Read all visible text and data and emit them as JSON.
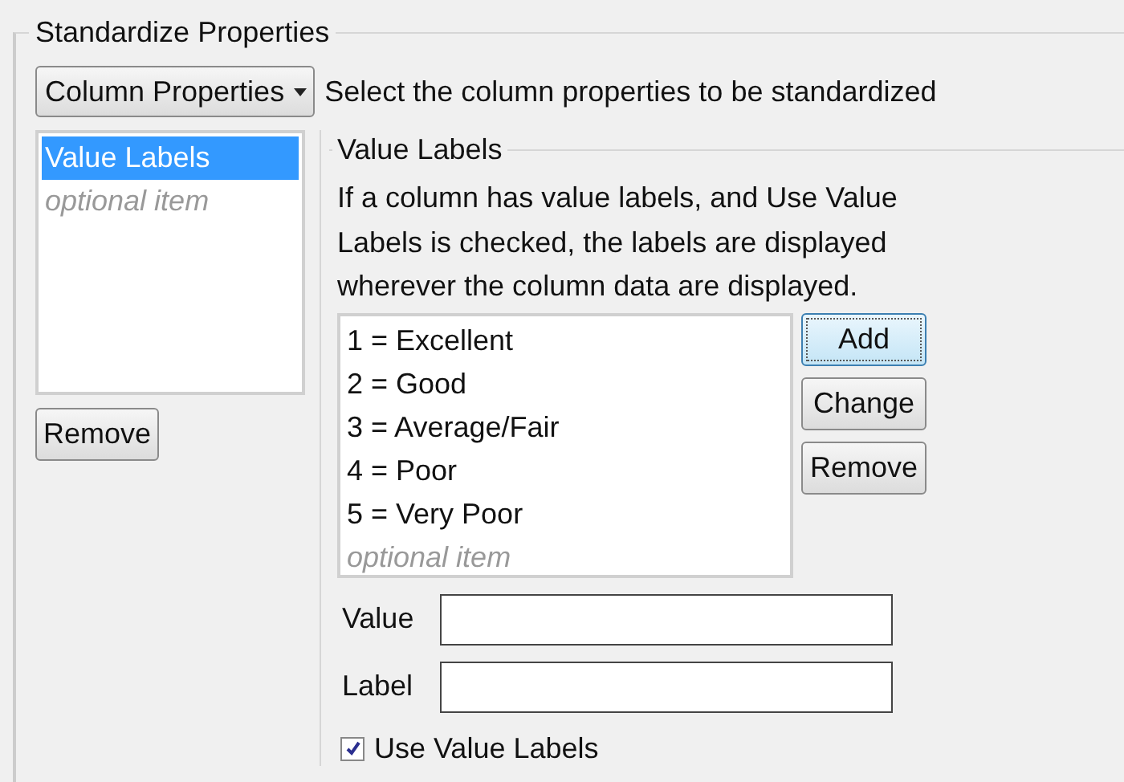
{
  "group_title": "Standardize Properties",
  "dropdown": {
    "value": "Column Properties"
  },
  "dropdown_hint": "Select the column properties to be standardized",
  "property_list": [
    {
      "label": "Value Labels",
      "selected": true,
      "kind": "item"
    },
    {
      "label": "optional item",
      "selected": false,
      "kind": "placeholder"
    }
  ],
  "remove_property_button": "Remove",
  "value_labels": {
    "title": "Value Labels",
    "description": "If a column has value labels, and Use Value Labels is checked, the labels are displayed wherever the column data are displayed.",
    "items": [
      {
        "label": "1 = Excellent",
        "kind": "item"
      },
      {
        "label": "2 = Good",
        "kind": "item"
      },
      {
        "label": "3 = Average/Fair",
        "kind": "item"
      },
      {
        "label": "4 = Poor",
        "kind": "item"
      },
      {
        "label": "5 = Very Poor",
        "kind": "item"
      },
      {
        "label": "optional item",
        "kind": "placeholder"
      }
    ],
    "buttons": [
      {
        "label": "Add",
        "focused": true
      },
      {
        "label": "Change",
        "focused": false
      },
      {
        "label": "Remove",
        "focused": false
      }
    ],
    "fields": [
      {
        "label": "Value"
      },
      {
        "label": "Label"
      }
    ],
    "use_value_labels": {
      "label": "Use Value Labels",
      "checked": true
    }
  }
}
